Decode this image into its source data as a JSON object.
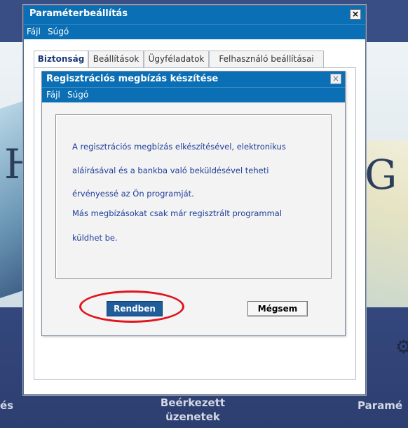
{
  "background": {
    "left_letter": "H",
    "right_letter": "G",
    "nav": {
      "left_partial": "és",
      "center_line1": "Beérkezett",
      "center_line2": "üzenetek",
      "right_partial": "Paramé"
    },
    "gear_icon": "gear-icon"
  },
  "outer_window": {
    "title": "Paraméterbeállítás",
    "close_label": "×",
    "menu": [
      "Fájl",
      "Súgó"
    ],
    "tabs": [
      "Biztonság",
      "Beállítások",
      "Ügyféladatok",
      "Felhasználó beállításai"
    ],
    "active_tab": "Biztonság"
  },
  "dialog": {
    "title": "Regisztrációs megbízás készítése",
    "close_label": "×",
    "menu": [
      "Fájl",
      "Súgó"
    ],
    "message_lines": [
      "A regisztrációs megbízás elkészítésével, elektronikus",
      "aláírásával és a bankba való beküldésével teheti",
      "érvényessé az Ön programját.",
      "Más megbízásokat csak már regisztrált programmal",
      "küldhet be."
    ],
    "ok_label": "Rendben",
    "cancel_label": "Mégsem"
  },
  "colors": {
    "titlebar": "#0a6fb4",
    "highlight": "#e0141d",
    "message_text": "#1d3d9a",
    "ok_button": "#1f5c9a"
  }
}
